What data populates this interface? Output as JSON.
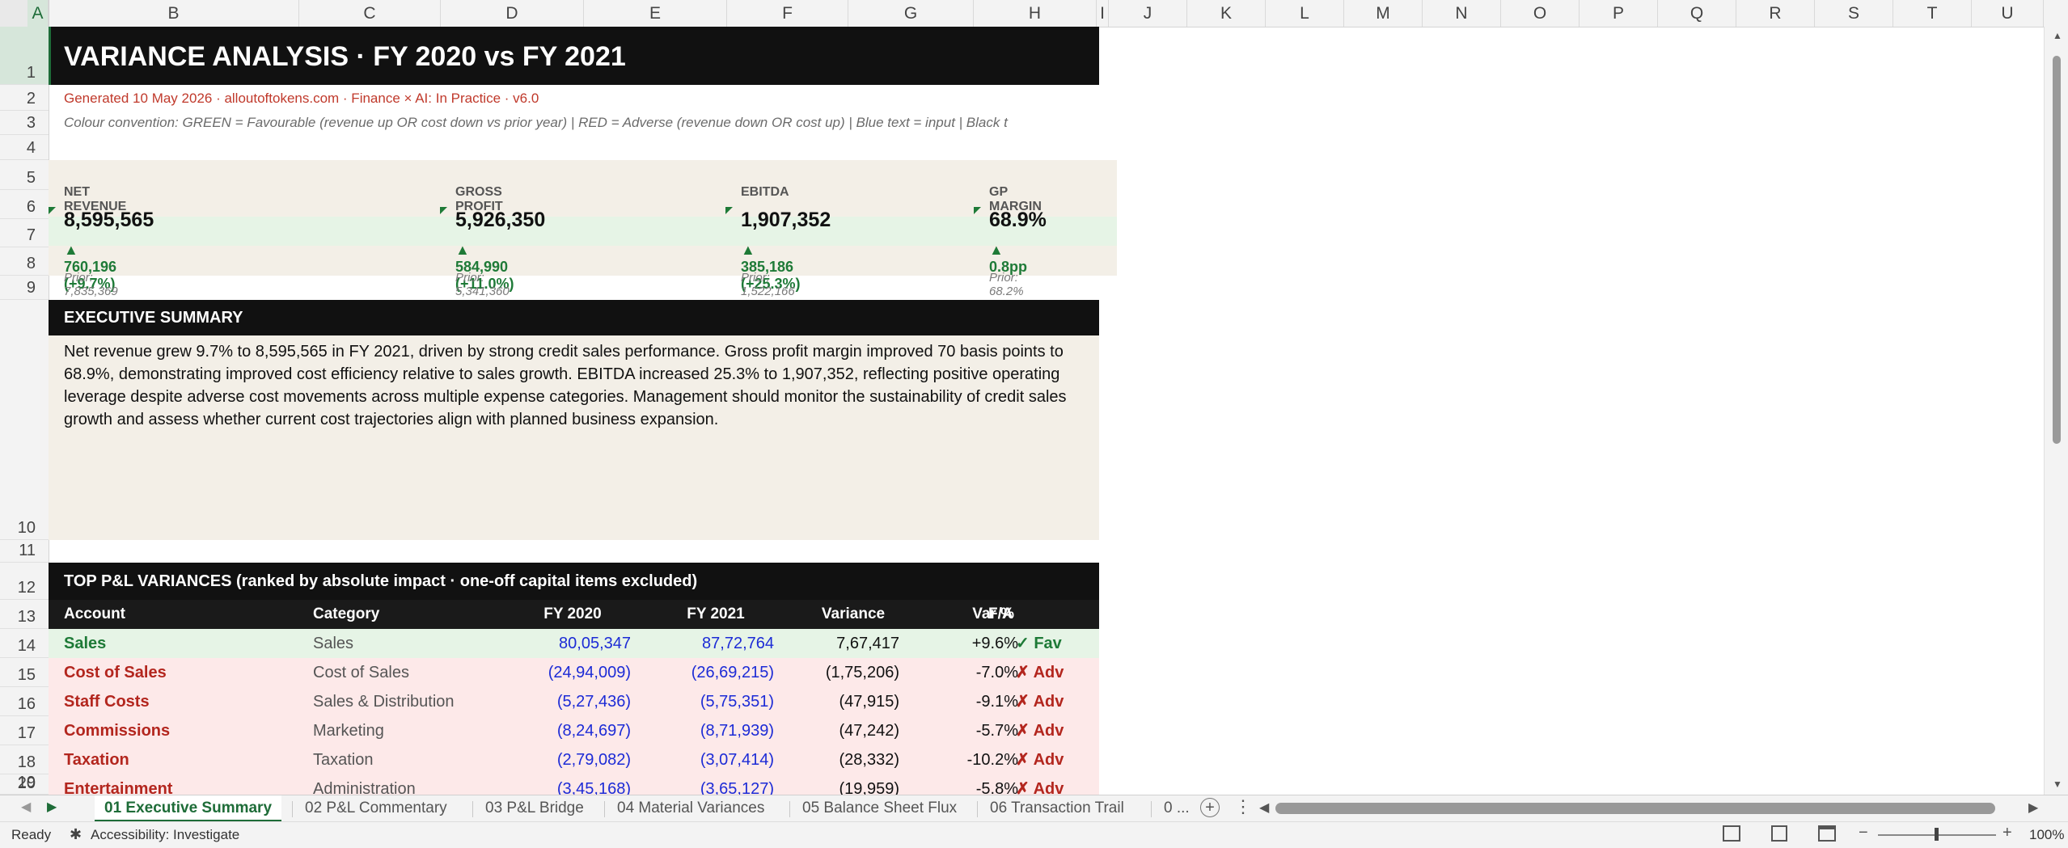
{
  "columns": [
    "A",
    "B",
    "C",
    "D",
    "E",
    "F",
    "G",
    "H",
    "I",
    "J",
    "K",
    "L",
    "M",
    "N",
    "O",
    "P",
    "Q",
    "R",
    "S",
    "T",
    "U"
  ],
  "rows": [
    "1",
    "2",
    "3",
    "4",
    "5",
    "6",
    "7",
    "8",
    "9",
    "10",
    "11",
    "12",
    "13",
    "14",
    "15",
    "16",
    "17",
    "18",
    "19",
    "20"
  ],
  "title": "VARIANCE ANALYSIS  ·  FY 2020 vs FY 2021",
  "generated": "Generated 10 May 2026  ·  alloutoftokens.com  ·  Finance × AI: In Practice  ·  v6.0",
  "convention": "Colour convention:  GREEN = Favourable (revenue up OR cost down vs prior year)  |  RED = Adverse (revenue down OR cost up)  |  Blue text = input  |  Black t",
  "kpis": [
    {
      "label": "NET REVENUE",
      "value": "8,595,565",
      "delta": "▲ 760,196  (+9.7%)",
      "prior": "Prior: 7,835,369"
    },
    {
      "label": "GROSS PROFIT",
      "value": "5,926,350",
      "delta": "▲ 584,990  (+11.0%)",
      "prior": "Prior: 5,341,360"
    },
    {
      "label": "EBITDA",
      "value": "1,907,352",
      "delta": "▲ 385,186  (+25.3%)",
      "prior": "Prior: 1,522,166"
    },
    {
      "label": "GP MARGIN",
      "value": "68.9%",
      "delta": "▲ 0.8pp",
      "prior": "Prior: 68.2%"
    }
  ],
  "exec": {
    "heading": "EXECUTIVE SUMMARY",
    "body": "Net revenue grew 9.7% to 8,595,565 in FY 2021, driven by strong credit sales performance. Gross profit margin improved 70 basis points to 68.9%, demonstrating improved cost efficiency relative to sales growth. EBITDA increased 25.3% to 1,907,352, reflecting positive operating leverage despite adverse cost movements across multiple expense categories. Management should monitor the sustainability of credit sales growth and assess whether current cost trajectories align with planned business expansion."
  },
  "variances": {
    "heading": "TOP P&L VARIANCES  (ranked by absolute impact · one-off capital items excluded)",
    "columns": [
      "Account",
      "Category",
      "FY 2020",
      "FY 2021",
      "Variance",
      "Var %",
      "F/A"
    ],
    "rows": [
      {
        "account": "Sales",
        "category": "Sales",
        "fy2020": "80,05,347",
        "fy2021": "87,72,764",
        "variance": "7,67,417",
        "pct": "+9.6%",
        "fa": "✓ Fav",
        "kind": "fav"
      },
      {
        "account": "Cost of Sales",
        "category": "Cost of Sales",
        "fy2020": "(24,94,009)",
        "fy2021": "(26,69,215)",
        "variance": "(1,75,206)",
        "pct": "-7.0%",
        "fa": "✗ Adv",
        "kind": "adv"
      },
      {
        "account": "Staff Costs",
        "category": "Sales & Distribution",
        "fy2020": "(5,27,436)",
        "fy2021": "(5,75,351)",
        "variance": "(47,915)",
        "pct": "-9.1%",
        "fa": "✗ Adv",
        "kind": "adv"
      },
      {
        "account": "Commissions",
        "category": "Marketing",
        "fy2020": "(8,24,697)",
        "fy2021": "(8,71,939)",
        "variance": "(47,242)",
        "pct": "-5.7%",
        "fa": "✗ Adv",
        "kind": "adv"
      },
      {
        "account": "Taxation",
        "category": "Taxation",
        "fy2020": "(2,79,082)",
        "fy2021": "(3,07,414)",
        "variance": "(28,332)",
        "pct": "-10.2%",
        "fa": "✗ Adv",
        "kind": "adv"
      },
      {
        "account": "Entertainment",
        "category": "Administration",
        "fy2020": "(3,45,168)",
        "fy2021": "(3,65,127)",
        "variance": "(19,959)",
        "pct": "-5.8%",
        "fa": "✗ Adv",
        "kind": "adv"
      }
    ]
  },
  "tabs": [
    "01 Executive Summary",
    "02 P&L Commentary",
    "03 P&L Bridge",
    "04 Material Variances",
    "05 Balance Sheet Flux",
    "06 Transaction Trail",
    "0 ..."
  ],
  "status": {
    "ready": "Ready",
    "accessibility": "Accessibility: Investigate",
    "zoom": "100%"
  },
  "colors": {
    "fav_bg": "#e6f4e6",
    "adv_bg": "#fde9e9",
    "header_bg": "#111111",
    "panel_bg": "#f3efe7",
    "fav": "#1e7a37",
    "adv": "#b3261e"
  }
}
